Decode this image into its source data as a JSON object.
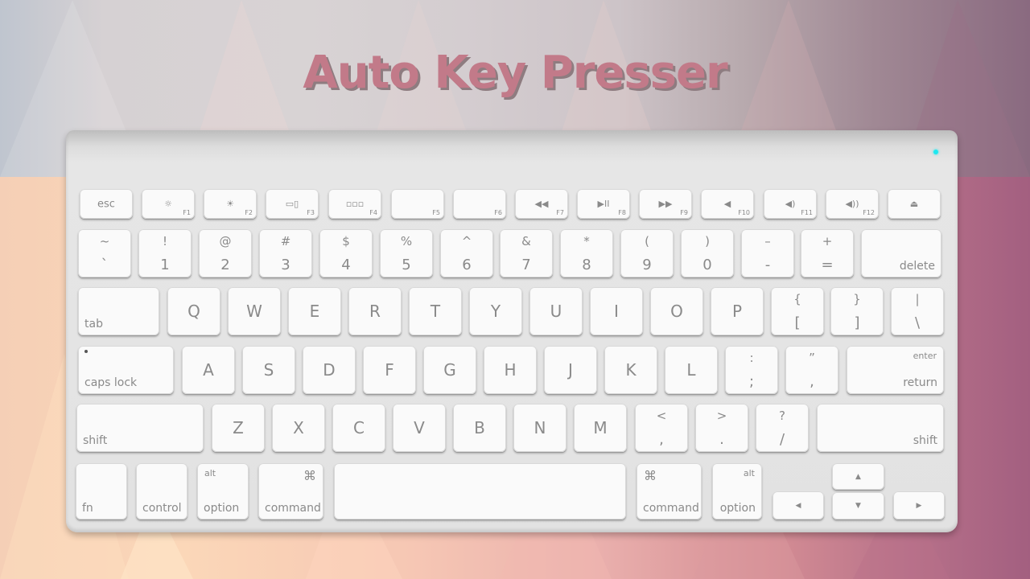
{
  "title": "Auto Key Presser",
  "colors": {
    "title": "#c27a89",
    "led": "#1ee8f0",
    "key": "#fafafa",
    "legend": "#8a8a8a"
  },
  "keyboard": {
    "fn_row": [
      {
        "label": "esc",
        "fn": ""
      },
      {
        "icon": "brightness-down-icon",
        "glyph": "☼",
        "fn": "F1"
      },
      {
        "icon": "brightness-up-icon",
        "glyph": "☀",
        "fn": "F2"
      },
      {
        "icon": "mission-control-icon",
        "glyph": "▭▯",
        "fn": "F3"
      },
      {
        "icon": "launchpad-icon",
        "glyph": "▫▫▫",
        "fn": "F4"
      },
      {
        "icon": "",
        "glyph": "",
        "fn": "F5"
      },
      {
        "icon": "",
        "glyph": "",
        "fn": "F6"
      },
      {
        "icon": "rewind-icon",
        "glyph": "◀◀",
        "fn": "F7"
      },
      {
        "icon": "play-pause-icon",
        "glyph": "▶II",
        "fn": "F8"
      },
      {
        "icon": "fast-forward-icon",
        "glyph": "▶▶",
        "fn": "F9"
      },
      {
        "icon": "mute-icon",
        "glyph": "◀",
        "fn": "F10"
      },
      {
        "icon": "volume-down-icon",
        "glyph": "◀)",
        "fn": "F11"
      },
      {
        "icon": "volume-up-icon",
        "glyph": "◀))",
        "fn": "F12"
      },
      {
        "icon": "eject-icon",
        "glyph": "⏏",
        "fn": ""
      }
    ],
    "number_row": [
      {
        "top": "~",
        "bot": "`"
      },
      {
        "top": "!",
        "bot": "1"
      },
      {
        "top": "@",
        "bot": "2"
      },
      {
        "top": "#",
        "bot": "3"
      },
      {
        "top": "$",
        "bot": "4"
      },
      {
        "top": "%",
        "bot": "5"
      },
      {
        "top": "^",
        "bot": "6"
      },
      {
        "top": "&",
        "bot": "7"
      },
      {
        "top": "*",
        "bot": "8"
      },
      {
        "top": "(",
        "bot": "9"
      },
      {
        "top": ")",
        "bot": "0"
      },
      {
        "top": "–",
        "bot": "-"
      },
      {
        "top": "+",
        "bot": "="
      },
      {
        "label": "delete"
      }
    ],
    "qwerty_row": [
      {
        "label": "tab"
      },
      {
        "big": "Q"
      },
      {
        "big": "W"
      },
      {
        "big": "E"
      },
      {
        "big": "R"
      },
      {
        "big": "T"
      },
      {
        "big": "Y"
      },
      {
        "big": "U"
      },
      {
        "big": "I"
      },
      {
        "big": "O"
      },
      {
        "big": "P"
      },
      {
        "top": "{",
        "bot": "["
      },
      {
        "top": "}",
        "bot": "]"
      },
      {
        "top": "|",
        "bot": "\\"
      }
    ],
    "home_row": [
      {
        "label": "caps lock"
      },
      {
        "big": "A"
      },
      {
        "big": "S"
      },
      {
        "big": "D"
      },
      {
        "big": "F"
      },
      {
        "big": "G"
      },
      {
        "big": "H"
      },
      {
        "big": "J"
      },
      {
        "big": "K"
      },
      {
        "big": "L"
      },
      {
        "top": ":",
        "bot": ";"
      },
      {
        "top": "”",
        "bot": ","
      },
      {
        "label": "return",
        "sub": "enter"
      }
    ],
    "bottom_row": [
      {
        "label": "shift"
      },
      {
        "big": "Z"
      },
      {
        "big": "X"
      },
      {
        "big": "C"
      },
      {
        "big": "V"
      },
      {
        "big": "B"
      },
      {
        "big": "N"
      },
      {
        "big": "M"
      },
      {
        "top": "<",
        "bot": ","
      },
      {
        "top": ">",
        "bot": "."
      },
      {
        "top": "?",
        "bot": "/"
      },
      {
        "label": "shift"
      }
    ],
    "modifier_row": [
      {
        "label": "fn"
      },
      {
        "label": "control"
      },
      {
        "label": "option",
        "sub": "alt"
      },
      {
        "label": "command",
        "sub": "⌘"
      },
      {
        "label": ""
      },
      {
        "label": "command",
        "sub": "⌘"
      },
      {
        "label": "option",
        "sub": "alt"
      },
      {
        "glyph": "◀"
      },
      {
        "glyph": "▲"
      },
      {
        "glyph": "▼"
      },
      {
        "glyph": "▶"
      }
    ]
  }
}
